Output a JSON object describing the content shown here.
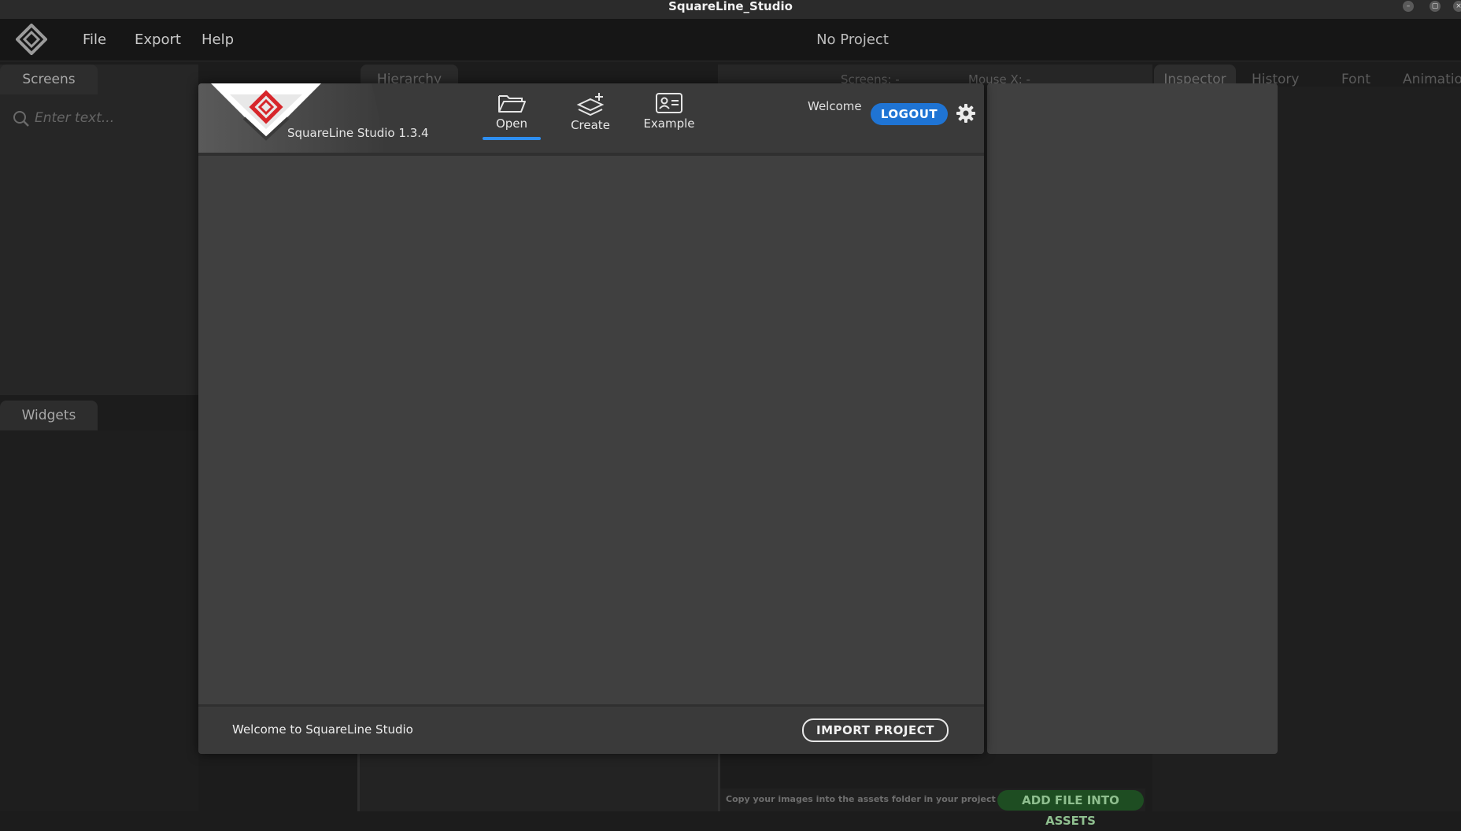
{
  "window": {
    "title": "SquareLine_Studio",
    "controls": [
      "–",
      "▢",
      "×"
    ]
  },
  "menubar": {
    "items": [
      "File",
      "Export",
      "Help"
    ],
    "project_status": "No Project"
  },
  "left_panels": {
    "screens_tab": "Screens",
    "search_placeholder": "Enter text...",
    "widgets_tab": "Widgets"
  },
  "background": {
    "hierarchy_tab": "Hierarchy",
    "screens_readout": "Screens: -",
    "mouse_x_readout": "Mouse X: -",
    "right_tabs": [
      "Inspector",
      "History",
      "Font",
      "Animation"
    ],
    "assets_hint": "Copy your images into the assets folder in your project folder",
    "add_assets_label": "ADD FILE INTO ASSETS"
  },
  "modal": {
    "version": "SquareLine Studio 1.3.4",
    "tabs": [
      {
        "label": "Open",
        "icon": "folder-open-icon",
        "active": true
      },
      {
        "label": "Create",
        "icon": "layers-add-icon",
        "active": false
      },
      {
        "label": "Example",
        "icon": "id-card-icon",
        "active": false
      }
    ],
    "welcome": "Welcome",
    "logout_label": "LOGOUT",
    "footer_text": "Welcome to SquareLine Studio",
    "import_label": "IMPORT PROJECT"
  },
  "colors": {
    "accent_blue": "#1f74d4",
    "brand_red": "#d7262b",
    "add_assets_green": "#1e4d22"
  }
}
